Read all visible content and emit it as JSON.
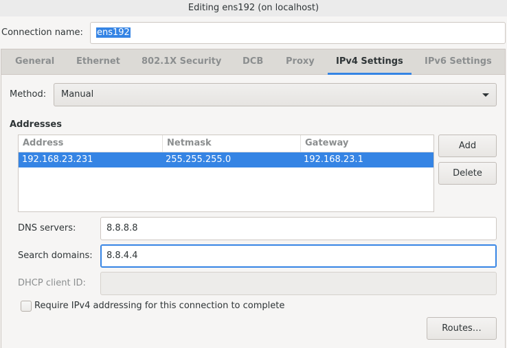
{
  "window": {
    "title": "Editing ens192 (on localhost)"
  },
  "connection": {
    "label": "Connection name:",
    "value": "ens192"
  },
  "tabs": [
    {
      "label": "General"
    },
    {
      "label": "Ethernet"
    },
    {
      "label": "802.1X Security"
    },
    {
      "label": "DCB"
    },
    {
      "label": "Proxy"
    },
    {
      "label": "IPv4 Settings",
      "active": true
    },
    {
      "label": "IPv6 Settings"
    }
  ],
  "method": {
    "label": "Method:",
    "value": "Manual"
  },
  "addresses": {
    "heading": "Addresses",
    "columns": [
      "Address",
      "Netmask",
      "Gateway"
    ],
    "rows": [
      {
        "address": "192.168.23.231",
        "netmask": "255.255.255.0",
        "gateway": "192.168.23.1",
        "selected": true
      }
    ],
    "add_label": "Add",
    "delete_label": "Delete"
  },
  "dns": {
    "label": "DNS servers:",
    "value": "8.8.8.8"
  },
  "search": {
    "label": "Search domains:",
    "value": "8.8.4.4"
  },
  "dhcp": {
    "label": "DHCP client ID:",
    "value": ""
  },
  "require_ipv4": {
    "label": "Require IPv4 addressing for this connection to complete",
    "checked": false
  },
  "routes_label": "Routes…",
  "colors": {
    "accent": "#3584e4",
    "selection_text": "#ffffff"
  }
}
